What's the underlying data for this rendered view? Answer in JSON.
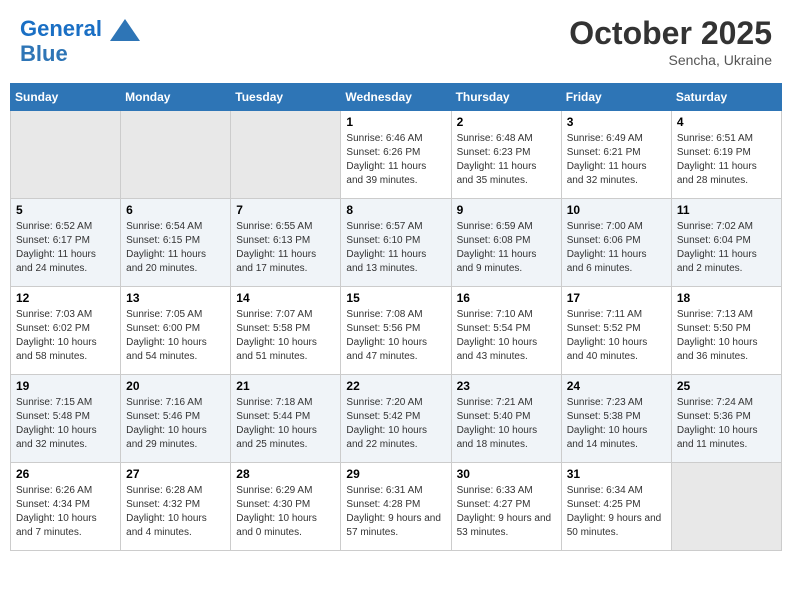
{
  "header": {
    "logo_line1": "General",
    "logo_line2": "Blue",
    "month": "October 2025",
    "location": "Sencha, Ukraine"
  },
  "weekdays": [
    "Sunday",
    "Monday",
    "Tuesday",
    "Wednesday",
    "Thursday",
    "Friday",
    "Saturday"
  ],
  "weeks": [
    [
      {
        "day": "",
        "info": ""
      },
      {
        "day": "",
        "info": ""
      },
      {
        "day": "",
        "info": ""
      },
      {
        "day": "1",
        "info": "Sunrise: 6:46 AM\nSunset: 6:26 PM\nDaylight: 11 hours and 39 minutes."
      },
      {
        "day": "2",
        "info": "Sunrise: 6:48 AM\nSunset: 6:23 PM\nDaylight: 11 hours and 35 minutes."
      },
      {
        "day": "3",
        "info": "Sunrise: 6:49 AM\nSunset: 6:21 PM\nDaylight: 11 hours and 32 minutes."
      },
      {
        "day": "4",
        "info": "Sunrise: 6:51 AM\nSunset: 6:19 PM\nDaylight: 11 hours and 28 minutes."
      }
    ],
    [
      {
        "day": "5",
        "info": "Sunrise: 6:52 AM\nSunset: 6:17 PM\nDaylight: 11 hours and 24 minutes."
      },
      {
        "day": "6",
        "info": "Sunrise: 6:54 AM\nSunset: 6:15 PM\nDaylight: 11 hours and 20 minutes."
      },
      {
        "day": "7",
        "info": "Sunrise: 6:55 AM\nSunset: 6:13 PM\nDaylight: 11 hours and 17 minutes."
      },
      {
        "day": "8",
        "info": "Sunrise: 6:57 AM\nSunset: 6:10 PM\nDaylight: 11 hours and 13 minutes."
      },
      {
        "day": "9",
        "info": "Sunrise: 6:59 AM\nSunset: 6:08 PM\nDaylight: 11 hours and 9 minutes."
      },
      {
        "day": "10",
        "info": "Sunrise: 7:00 AM\nSunset: 6:06 PM\nDaylight: 11 hours and 6 minutes."
      },
      {
        "day": "11",
        "info": "Sunrise: 7:02 AM\nSunset: 6:04 PM\nDaylight: 11 hours and 2 minutes."
      }
    ],
    [
      {
        "day": "12",
        "info": "Sunrise: 7:03 AM\nSunset: 6:02 PM\nDaylight: 10 hours and 58 minutes."
      },
      {
        "day": "13",
        "info": "Sunrise: 7:05 AM\nSunset: 6:00 PM\nDaylight: 10 hours and 54 minutes."
      },
      {
        "day": "14",
        "info": "Sunrise: 7:07 AM\nSunset: 5:58 PM\nDaylight: 10 hours and 51 minutes."
      },
      {
        "day": "15",
        "info": "Sunrise: 7:08 AM\nSunset: 5:56 PM\nDaylight: 10 hours and 47 minutes."
      },
      {
        "day": "16",
        "info": "Sunrise: 7:10 AM\nSunset: 5:54 PM\nDaylight: 10 hours and 43 minutes."
      },
      {
        "day": "17",
        "info": "Sunrise: 7:11 AM\nSunset: 5:52 PM\nDaylight: 10 hours and 40 minutes."
      },
      {
        "day": "18",
        "info": "Sunrise: 7:13 AM\nSunset: 5:50 PM\nDaylight: 10 hours and 36 minutes."
      }
    ],
    [
      {
        "day": "19",
        "info": "Sunrise: 7:15 AM\nSunset: 5:48 PM\nDaylight: 10 hours and 32 minutes."
      },
      {
        "day": "20",
        "info": "Sunrise: 7:16 AM\nSunset: 5:46 PM\nDaylight: 10 hours and 29 minutes."
      },
      {
        "day": "21",
        "info": "Sunrise: 7:18 AM\nSunset: 5:44 PM\nDaylight: 10 hours and 25 minutes."
      },
      {
        "day": "22",
        "info": "Sunrise: 7:20 AM\nSunset: 5:42 PM\nDaylight: 10 hours and 22 minutes."
      },
      {
        "day": "23",
        "info": "Sunrise: 7:21 AM\nSunset: 5:40 PM\nDaylight: 10 hours and 18 minutes."
      },
      {
        "day": "24",
        "info": "Sunrise: 7:23 AM\nSunset: 5:38 PM\nDaylight: 10 hours and 14 minutes."
      },
      {
        "day": "25",
        "info": "Sunrise: 7:24 AM\nSunset: 5:36 PM\nDaylight: 10 hours and 11 minutes."
      }
    ],
    [
      {
        "day": "26",
        "info": "Sunrise: 6:26 AM\nSunset: 4:34 PM\nDaylight: 10 hours and 7 minutes."
      },
      {
        "day": "27",
        "info": "Sunrise: 6:28 AM\nSunset: 4:32 PM\nDaylight: 10 hours and 4 minutes."
      },
      {
        "day": "28",
        "info": "Sunrise: 6:29 AM\nSunset: 4:30 PM\nDaylight: 10 hours and 0 minutes."
      },
      {
        "day": "29",
        "info": "Sunrise: 6:31 AM\nSunset: 4:28 PM\nDaylight: 9 hours and 57 minutes."
      },
      {
        "day": "30",
        "info": "Sunrise: 6:33 AM\nSunset: 4:27 PM\nDaylight: 9 hours and 53 minutes."
      },
      {
        "day": "31",
        "info": "Sunrise: 6:34 AM\nSunset: 4:25 PM\nDaylight: 9 hours and 50 minutes."
      },
      {
        "day": "",
        "info": ""
      }
    ]
  ]
}
